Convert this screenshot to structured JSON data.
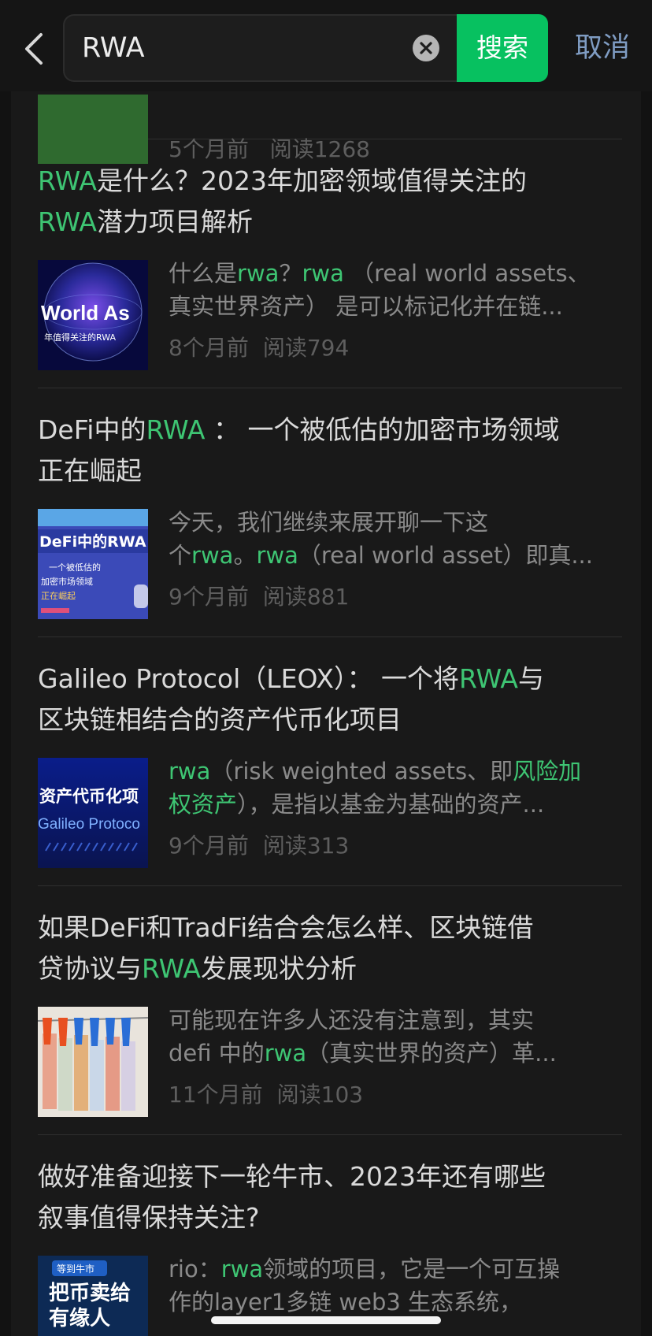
{
  "search": {
    "query": "RWA",
    "search_label": "搜索",
    "cancel_label": "取消"
  },
  "colors": {
    "accent": "#07c160",
    "highlight": "#3ec573",
    "cancel": "#7f9cc2"
  },
  "partial_item": {
    "time": "5个月前",
    "reads": "阅读1268"
  },
  "results": [
    {
      "title_lines": [
        [
          {
            "t": "RWA",
            "hl": true
          },
          {
            "t": "是什么？2023年加密领域值得关注的"
          }
        ],
        [
          {
            "t": "RWA",
            "hl": true
          },
          {
            "t": "潜力项目解析"
          }
        ]
      ],
      "snippet_lines": [
        [
          {
            "t": "什么是"
          },
          {
            "t": "rwa",
            "hl": true
          },
          {
            "t": "？"
          },
          {
            "t": "rwa",
            "hl": true
          },
          {
            "t": " （real world assets、"
          }
        ],
        [
          {
            "t": "真实世界资产） 是可以标记化并在链..."
          }
        ]
      ],
      "time": "8个月前",
      "reads": "阅读794",
      "thumb_icon": "rwa-globe-thumbnail",
      "thumb_text": [
        "World As",
        "年值得关注的RWA"
      ]
    },
    {
      "title_lines": [
        [
          {
            "t": "DeFi中的"
          },
          {
            "t": "RWA",
            "hl": true
          },
          {
            "t": " ： 一个被低估的加密市场领域"
          }
        ],
        [
          {
            "t": "正在崛起"
          }
        ]
      ],
      "snippet_lines": [
        [
          {
            "t": "今天，我们继续来展开聊一下这"
          }
        ],
        [
          {
            "t": "个"
          },
          {
            "t": "rwa",
            "hl": true
          },
          {
            "t": "。"
          },
          {
            "t": "rwa",
            "hl": true
          },
          {
            "t": "（real world asset）即真..."
          }
        ]
      ],
      "time": "9个月前",
      "reads": "阅读881",
      "thumb_icon": "defi-rwa-thumbnail",
      "thumb_text": [
        "DeFi中的RWA",
        "一个被低估的",
        "加密市场领域",
        "正在崛起"
      ]
    },
    {
      "title_lines": [
        [
          {
            "t": "Galileo Protocol（LEOX）： 一个将"
          },
          {
            "t": "RWA",
            "hl": true
          },
          {
            "t": "与"
          }
        ],
        [
          {
            "t": "区块链相结合的资产代币化项目"
          }
        ]
      ],
      "snippet_lines": [
        [
          {
            "t": "rwa",
            "hl": true
          },
          {
            "t": "（risk weighted assets、即"
          },
          {
            "t": "风险加",
            "hl": true
          }
        ],
        [
          {
            "t": "权资产",
            "hl": true
          },
          {
            "t": "），是指以基金为基础的资产..."
          }
        ]
      ],
      "time": "9个月前",
      "reads": "阅读313",
      "thumb_icon": "galileo-protocol-thumbnail",
      "thumb_text": [
        "资产代币化项",
        "Galileo  Protoco"
      ]
    },
    {
      "title_lines": [
        [
          {
            "t": "如果DeFi和TradFi结合会怎么样、区块链借"
          }
        ],
        [
          {
            "t": "贷协议与"
          },
          {
            "t": "RWA",
            "hl": true
          },
          {
            "t": "发展现状分析"
          }
        ]
      ],
      "snippet_lines": [
        [
          {
            "t": "可能现在许多人还没有注意到，其实"
          }
        ],
        [
          {
            "t": "defi 中的"
          },
          {
            "t": "rwa",
            "hl": true
          },
          {
            "t": "（真实世界的资产）革..."
          }
        ]
      ],
      "time": "11个月前",
      "reads": "阅读103",
      "thumb_icon": "banknotes-clothespins-thumbnail",
      "thumb_text": []
    },
    {
      "title_lines": [
        [
          {
            "t": "做好准备迎接下一轮牛市、2023年还有哪些"
          }
        ],
        [
          {
            "t": "叙事值得保持关注?"
          }
        ]
      ],
      "snippet_lines": [
        [
          {
            "t": "rio："
          },
          {
            "t": "rwa",
            "hl": true
          },
          {
            "t": "领域的项目，它是一个可互操"
          }
        ],
        [
          {
            "t": "作的layer1多链 web3 生态系统，"
          }
        ]
      ],
      "time": "",
      "reads": "",
      "thumb_icon": "bull-market-thumbnail",
      "thumb_text": [
        "等到牛市",
        "把币卖给",
        "有缘人"
      ]
    }
  ]
}
